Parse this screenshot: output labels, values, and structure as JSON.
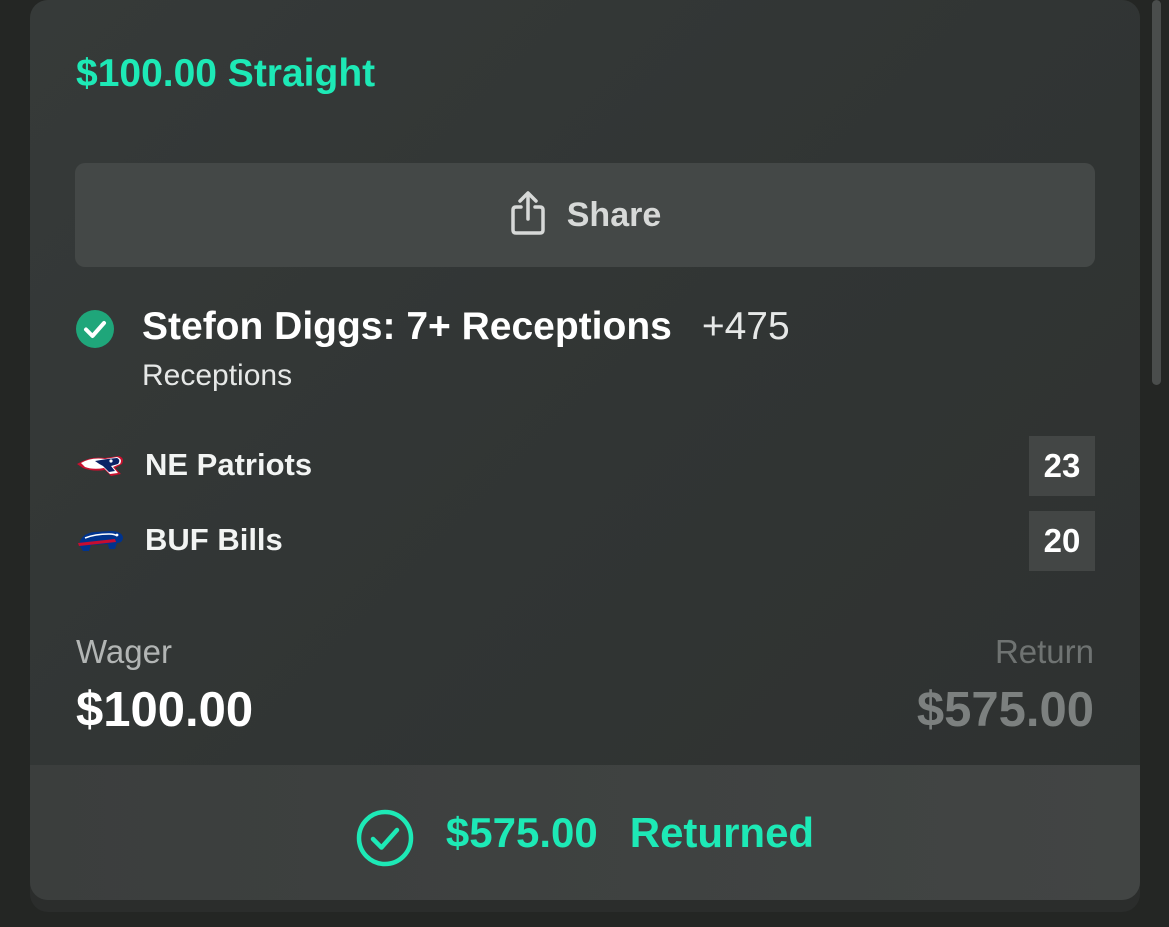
{
  "bet": {
    "title": "$100.00 Straight",
    "share_label": "Share"
  },
  "selection": {
    "name": "Stefon Diggs: 7+ Receptions",
    "odds": "+475",
    "market": "Receptions",
    "status": "won"
  },
  "teams": [
    {
      "name": "NE Patriots",
      "score": "23",
      "logo": "patriots-logo-icon"
    },
    {
      "name": "BUF Bills",
      "score": "20",
      "logo": "bills-logo-icon"
    }
  ],
  "summary": {
    "wager_label": "Wager",
    "wager_value": "$100.00",
    "return_label": "Return",
    "return_value": "$575.00"
  },
  "footer": {
    "amount": "$575.00",
    "status": "Returned"
  },
  "colors": {
    "accent": "#1de9b6",
    "check_fill": "#1fa67a",
    "card_bg": "#333736",
    "button_bg": "#444847"
  },
  "icons": {
    "share": "share-icon",
    "selection_check": "check-circle-icon",
    "footer_check": "check-circle-outline-icon"
  }
}
